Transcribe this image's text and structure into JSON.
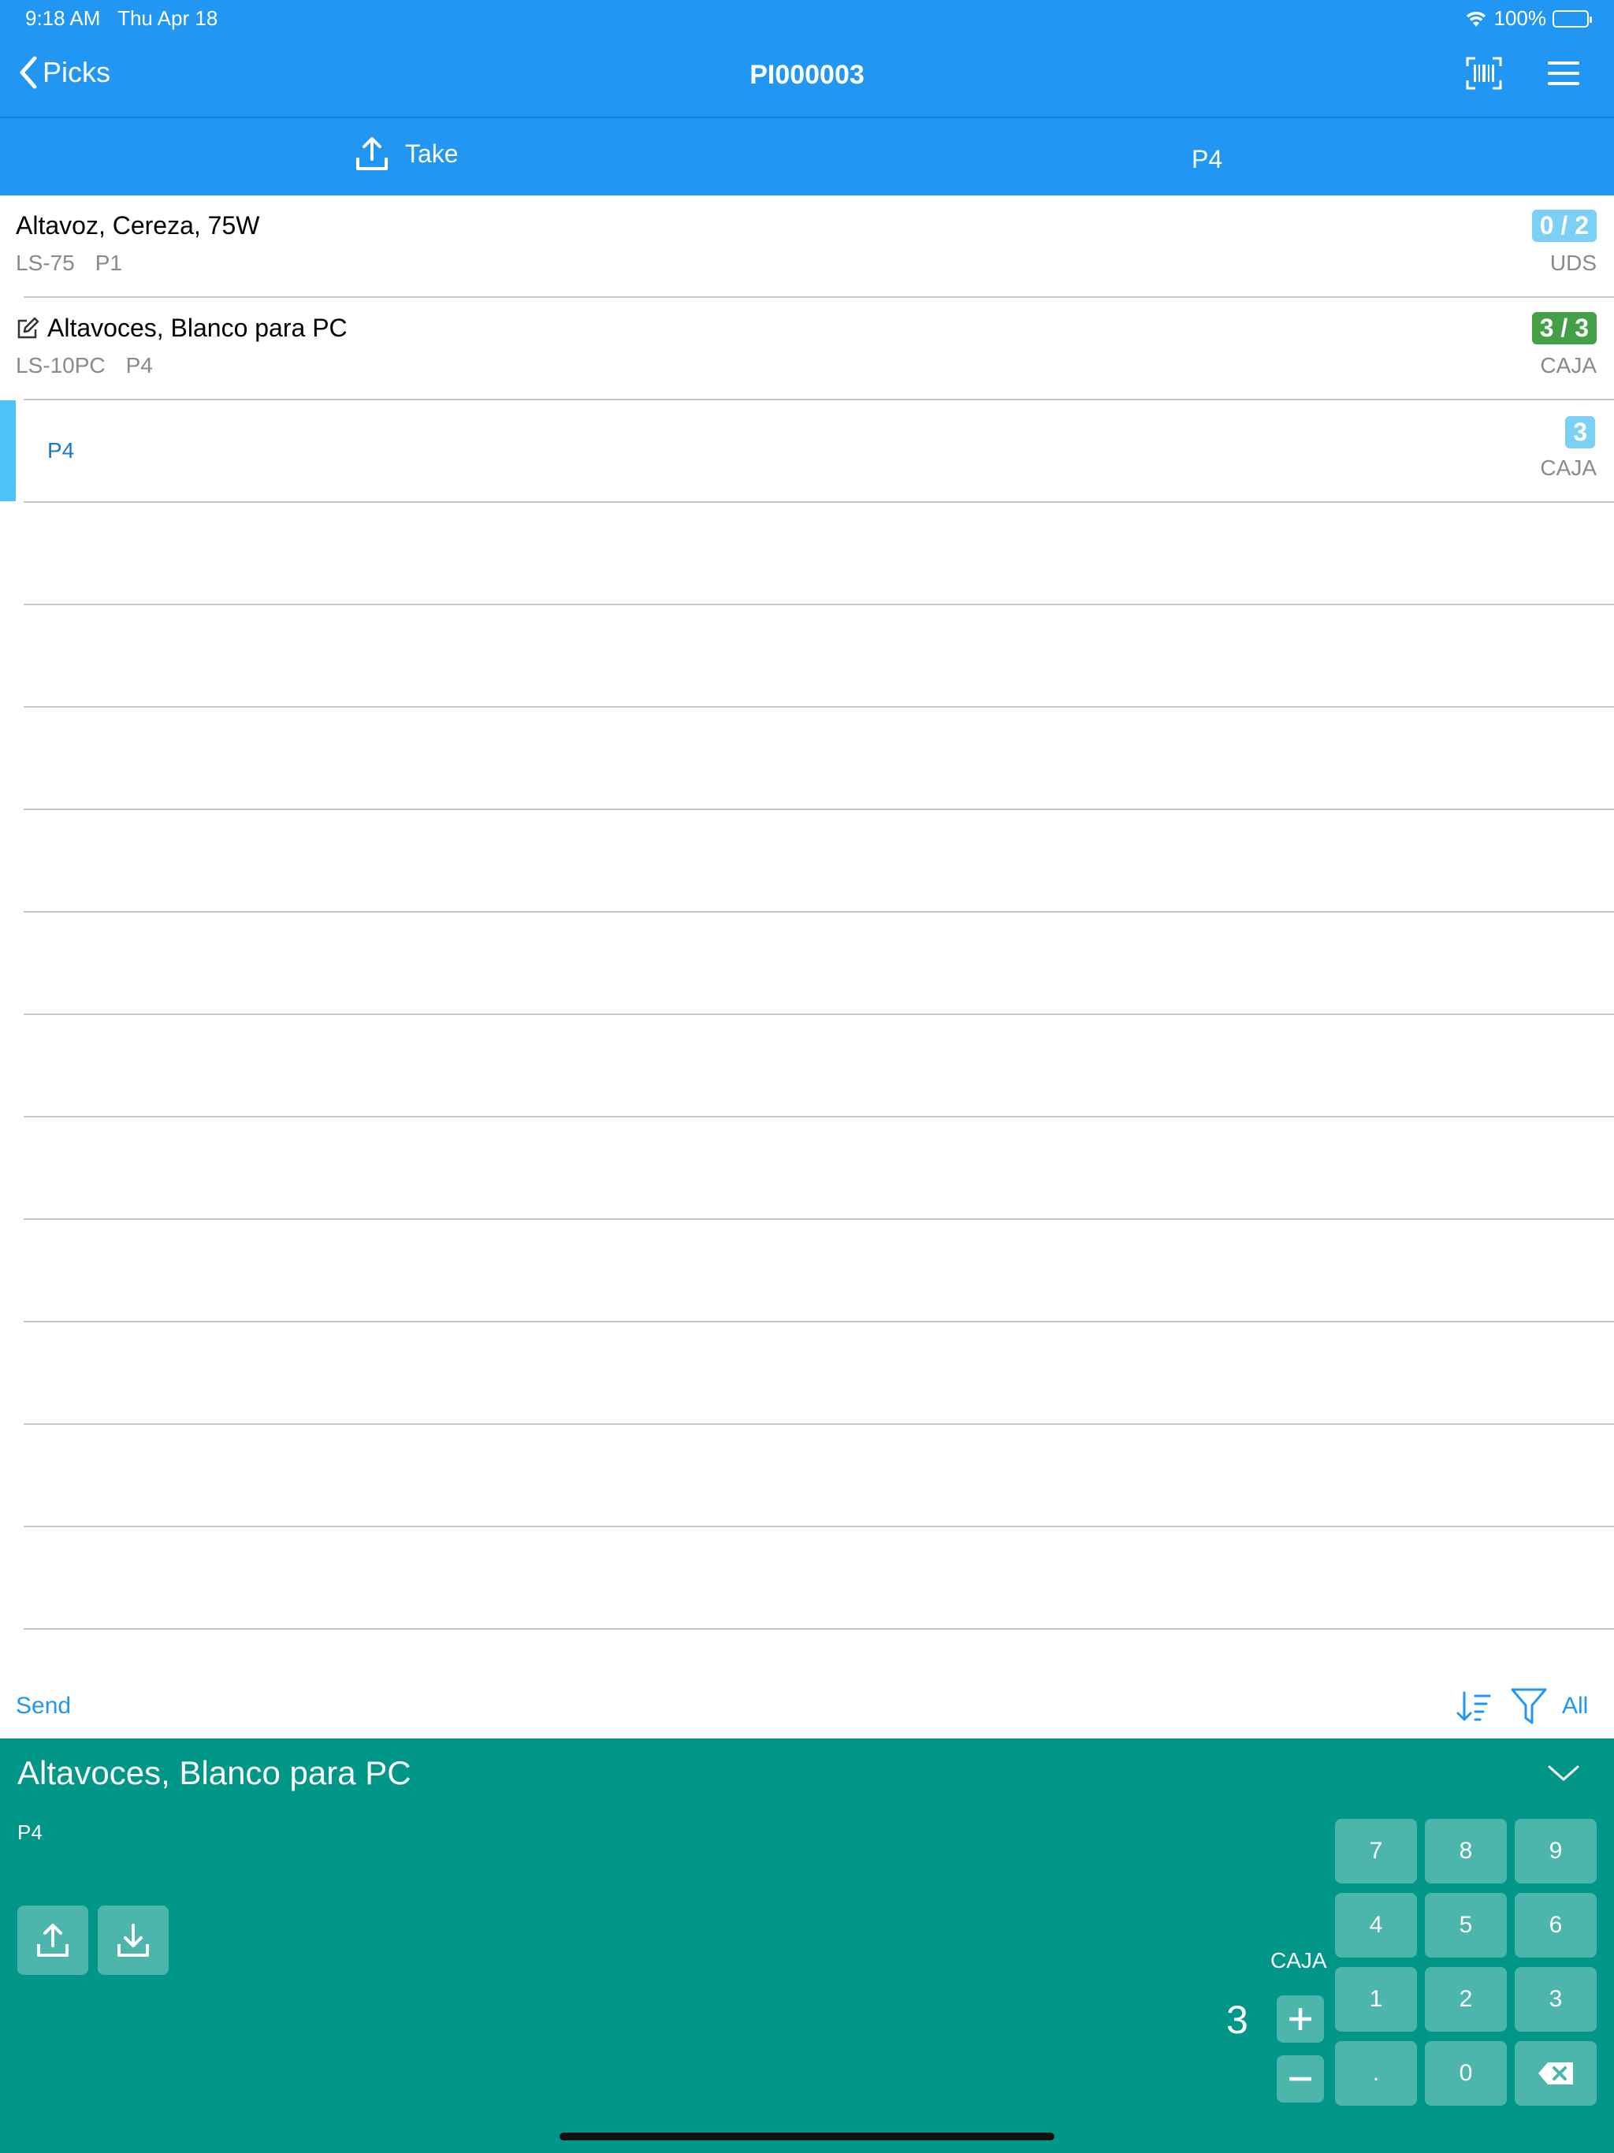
{
  "status": {
    "time": "9:18 AM",
    "date": "Thu Apr 18",
    "battery": "100%"
  },
  "nav": {
    "back_label": "Picks",
    "title": "PI000003"
  },
  "subbar": {
    "take_label": "Take",
    "location": "P4"
  },
  "items": [
    {
      "title": "Altavoz, Cereza, 75W",
      "code": "LS-75",
      "loc": "P1",
      "qty": "0 / 2",
      "unit": "UDS",
      "edited": false
    },
    {
      "title": "Altavoces, Blanco para PC",
      "code": "LS-10PC",
      "loc": "P4",
      "qty": "3 / 3",
      "unit": "CAJA",
      "edited": true
    }
  ],
  "subrow": {
    "loc": "P4",
    "qty": "3",
    "unit": "CAJA"
  },
  "footer": {
    "send_label": "Send",
    "filter_label": "All"
  },
  "panel": {
    "title": "Altavoces, Blanco para PC",
    "location": "P4",
    "unit": "CAJA",
    "quantity": "3",
    "keys": [
      "7",
      "8",
      "9",
      "4",
      "5",
      "6",
      "1",
      "2",
      "3",
      ".",
      "0"
    ]
  },
  "colors": {
    "primary": "#2196F3",
    "panel": "#009688",
    "key": "#4db6ac",
    "badge_light": "#7cd0f5",
    "badge_done": "#43a047"
  }
}
